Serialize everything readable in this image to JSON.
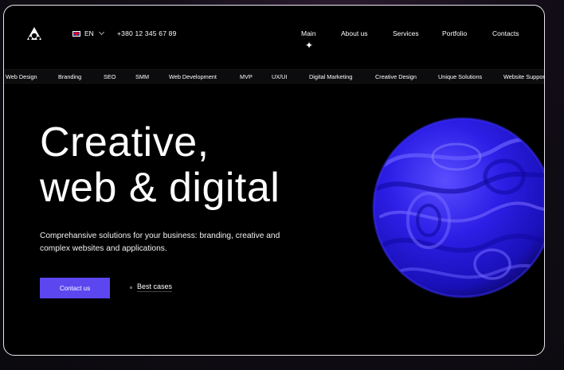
{
  "header": {
    "language": "EN",
    "phone": "+380 12 345 67 89",
    "nav": [
      "Main",
      "About us",
      "Services",
      "Portfolio",
      "Contacts"
    ]
  },
  "services_strip": [
    "Web Design",
    "Branding",
    "SEO",
    "SMM",
    "Web Development",
    "MVP",
    "UX/UI",
    "Digital Marketing",
    "Creative Design",
    "Unique Solutions",
    "Website Support"
  ],
  "hero": {
    "title_line1": "Creative,",
    "title_line2": "web & digital",
    "subtitle": "Comprehansive solutions for your business: branding, creative and complex websites and applications.",
    "cta_label": "Contact us",
    "secondary_label": "Best cases"
  },
  "colors": {
    "accent": "#5b46f0",
    "sphere": "#2a1ee0",
    "background": "#000000"
  }
}
